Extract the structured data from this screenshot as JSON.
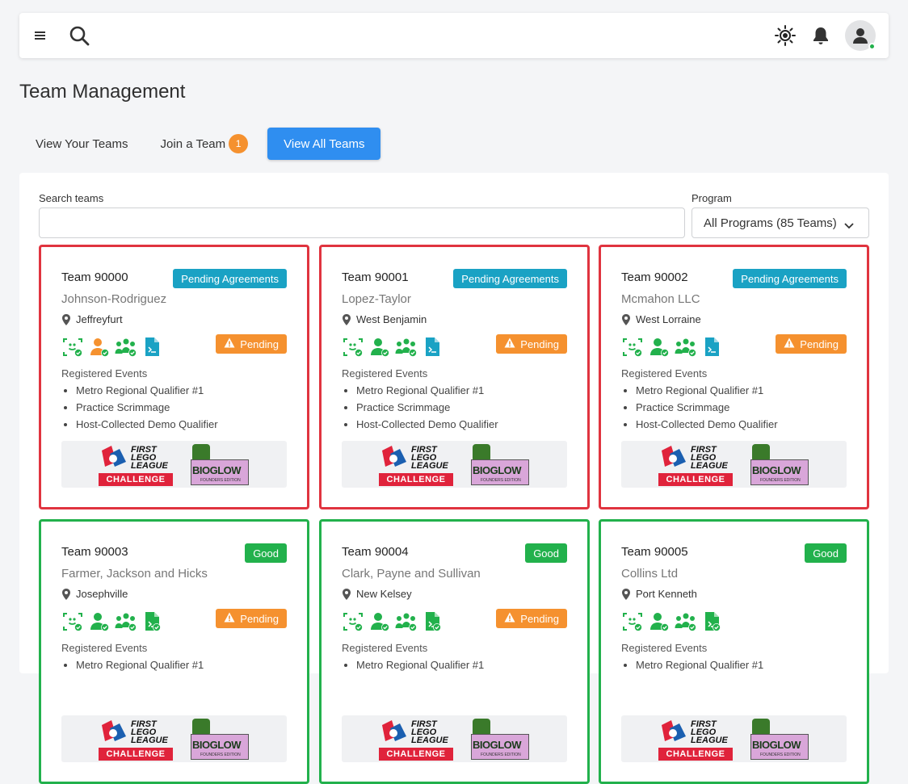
{
  "header": {
    "menu_icon": "menu-icon",
    "search_icon": "search-icon",
    "theme_icon": "sun-icon",
    "notification_icon": "bell-icon",
    "avatar_icon": "user-icon",
    "online_color": "#22b14c"
  },
  "page": {
    "title": "Team Management"
  },
  "tabs": [
    {
      "label": "View Your Teams"
    },
    {
      "label": "Join a Team",
      "badge": "1"
    },
    {
      "label": "View All Teams",
      "active": true
    }
  ],
  "filters": {
    "search_label": "Search teams",
    "search_value": "",
    "program_label": "Program",
    "program_value": "All Programs (85 Teams)"
  },
  "colors": {
    "pending_agreements": "#1aa2c4",
    "good": "#22b14c",
    "pending": "#f5912f",
    "card_border_bad": "#e0343f",
    "accent": "#2f8ef0"
  },
  "cards": [
    {
      "number": "Team 90000",
      "status": "Pending Agreements",
      "name": "Johnson-Rodriguez",
      "location": "Jeffreyfurt",
      "pending": "Pending",
      "registered_label": "Registered Events",
      "events": [
        "Metro Regional Qualifier #1",
        "Practice Scrimmage",
        "Host-Collected Demo Qualifier"
      ]
    },
    {
      "number": "Team 90001",
      "status": "Pending Agreements",
      "name": "Lopez-Taylor",
      "location": "West Benjamin",
      "pending": "Pending",
      "registered_label": "Registered Events",
      "events": [
        "Metro Regional Qualifier #1",
        "Practice Scrimmage",
        "Host-Collected Demo Qualifier"
      ]
    },
    {
      "number": "Team 90002",
      "status": "Pending Agreements",
      "name": "Mcmahon LLC",
      "location": "West Lorraine",
      "pending": "Pending",
      "registered_label": "Registered Events",
      "events": [
        "Metro Regional Qualifier #1",
        "Practice Scrimmage",
        "Host-Collected Demo Qualifier"
      ]
    },
    {
      "number": "Team 90003",
      "status": "Good",
      "name": "Farmer, Jackson and Hicks",
      "location": "Josephville",
      "pending": "Pending",
      "registered_label": "Registered Events",
      "events": [
        "Metro Regional Qualifier #1"
      ]
    },
    {
      "number": "Team 90004",
      "status": "Good",
      "name": "Clark, Payne and Sullivan",
      "location": "New Kelsey",
      "pending": "Pending",
      "registered_label": "Registered Events",
      "events": [
        "Metro Regional Qualifier #1"
      ]
    },
    {
      "number": "Team 90005",
      "status": "Good",
      "name": "Collins Ltd",
      "location": "Port Kenneth",
      "registered_label": "Registered Events",
      "events": [
        "Metro Regional Qualifier #1"
      ]
    }
  ],
  "logos": {
    "fll_line1": "FIRST",
    "fll_line2": "LEGO",
    "fll_line3": "LEAGUE",
    "fll_challenge": "CHALLENGE",
    "season": "BIOGLOW",
    "season_sub": "FOUNDERS EDITION"
  }
}
